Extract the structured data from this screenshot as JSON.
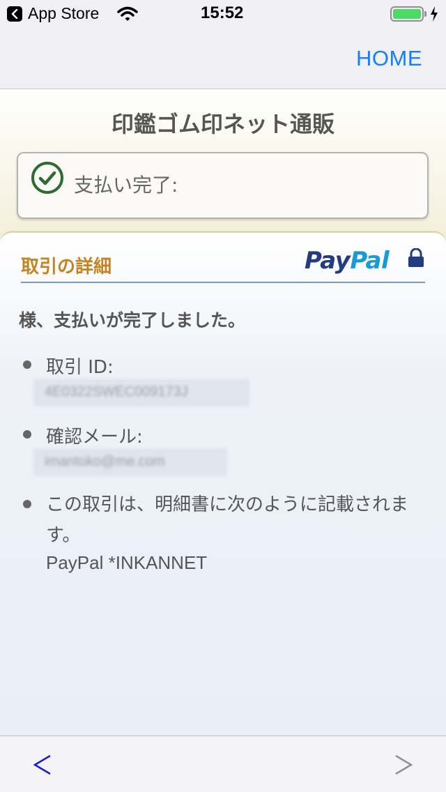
{
  "status_bar": {
    "back_app": "App Store",
    "time": "15:52"
  },
  "nav": {
    "home_label": "HOME"
  },
  "merchant": {
    "title": "印鑑ゴム印ネット通販"
  },
  "status_box": {
    "text": "支払い完了:"
  },
  "details": {
    "heading": "取引の詳細",
    "logo_pay": "Pay",
    "logo_pal": "Pal",
    "message": "様、支払いが完了しました。",
    "transaction_id_label": "取引 ID:",
    "transaction_id_value": "4E0322SWEC009173J",
    "email_label": "確認メール:",
    "email_value": "imantoko@me.com",
    "statement_note": "この取引は、明細書に次のように記載されます。",
    "statement_descriptor": "PayPal *INKANNET"
  },
  "colors": {
    "accent_blue": "#157efb",
    "heading_orange": "#c5831f",
    "paypal_dark": "#253b80",
    "paypal_light": "#179bd7",
    "check_green": "#2e6b2e"
  },
  "icons": [
    "back-app-icon",
    "wifi-icon",
    "battery-icon",
    "charging-icon",
    "check-circle-icon",
    "lock-icon",
    "back-arrow-icon",
    "forward-arrow-icon"
  ]
}
